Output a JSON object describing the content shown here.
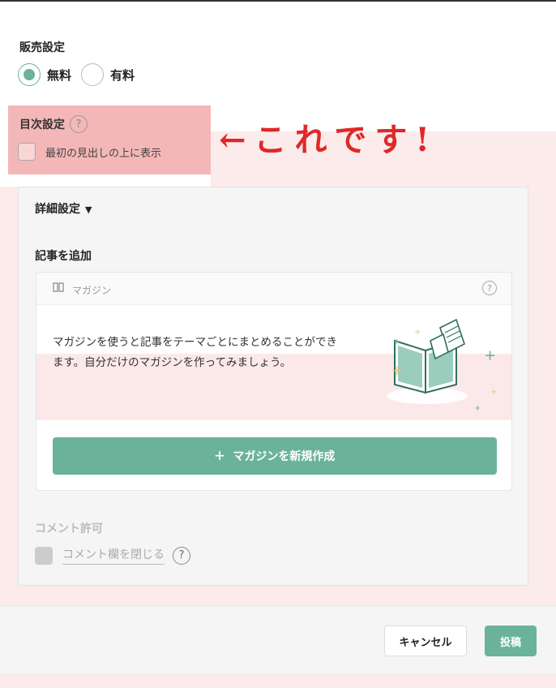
{
  "sales": {
    "title": "販売設定",
    "options": [
      {
        "label": "無料",
        "selected": true
      },
      {
        "label": "有料",
        "selected": false
      }
    ]
  },
  "toc": {
    "title": "目次設定",
    "checkbox_label": "最初の見出しの上に表示",
    "checked": false
  },
  "annotation": {
    "text": "←これです!"
  },
  "details": {
    "title": "詳細設定",
    "caret": "▼",
    "add_article_title": "記事を追加",
    "magazine": {
      "header_label": "マガジン",
      "description": "マガジンを使うと記事をテーマごとにまとめることができます。自分だけのマガジンを作ってみましょう。",
      "create_button_label": "マガジンを新規作成"
    },
    "comment": {
      "title": "コメント許可",
      "checkbox_label": "コメント欄を閉じる"
    }
  },
  "footer": {
    "cancel_label": "キャンセル",
    "post_label": "投稿"
  },
  "icons": {
    "help": "?",
    "book": "📖",
    "plus": "+"
  },
  "colors": {
    "accent": "#6ab39a",
    "highlight": "#f4b7b7",
    "annotation": "#e02828",
    "background": "#fbebeb"
  }
}
